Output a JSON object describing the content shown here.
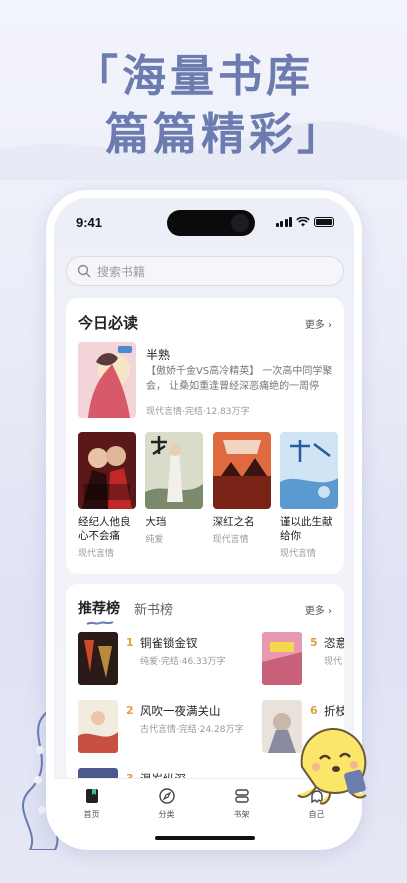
{
  "headline": {
    "line1": "「海量书库",
    "line2": "篇篇精彩」"
  },
  "status": {
    "time": "9:41"
  },
  "search": {
    "placeholder": "搜索书籍"
  },
  "today": {
    "title": "今日必读",
    "more": "更多",
    "feature": {
      "title": "半熟",
      "desc": "【傲娇千金VS高冷精英】 一次高中同学聚会， 让桑如重逢曾经深恶痛绝的一周停",
      "meta": "现代言情·完结·12.83万字"
    },
    "books": [
      {
        "title": "经纪人他良心不会痛",
        "tag": "现代言情",
        "cover_text": "经纪人他良心不会痛",
        "cover_color": "#8a2a2a"
      },
      {
        "title": "大珰",
        "tag": "纯爱",
        "cover_text": "大珰",
        "cover_color": "#7a8a6a"
      },
      {
        "title": "深红之名",
        "tag": "现代言情",
        "cover_text": "深红之名",
        "cover_color": "#b04030"
      },
      {
        "title": "谨以此生献给你",
        "tag": "现代言情",
        "cover_text": "谨以此生献给你",
        "cover_color": "#5a9ad0"
      }
    ]
  },
  "ranking": {
    "tab_active": "推荐榜",
    "tab_other": "新书榜",
    "more": "更多",
    "items": [
      {
        "num": "1",
        "title": "铜雀锁金钗",
        "meta": "纯爱·完结·46.33万字",
        "cover_color": "#2a1a18"
      },
      {
        "num": "2",
        "title": "风吹一夜满关山",
        "meta": "古代言情·完结·24.28万字",
        "cover_color": "#c85040"
      },
      {
        "num": "3",
        "title": "温岁纵深",
        "meta": "",
        "cover_color": "#4a5a8a"
      },
      {
        "num": "5",
        "title": "恣意",
        "meta": "现代",
        "cover_color": "#c8607a"
      },
      {
        "num": "6",
        "title": "折枝",
        "meta": "",
        "cover_color": "#d8d0c8"
      }
    ]
  },
  "tabbar": {
    "home": "首页",
    "category": "分类",
    "shelf": "书架",
    "me": "自己"
  },
  "colors": {
    "accent": "#6c7bb0",
    "rank_num": "#e0a040"
  }
}
